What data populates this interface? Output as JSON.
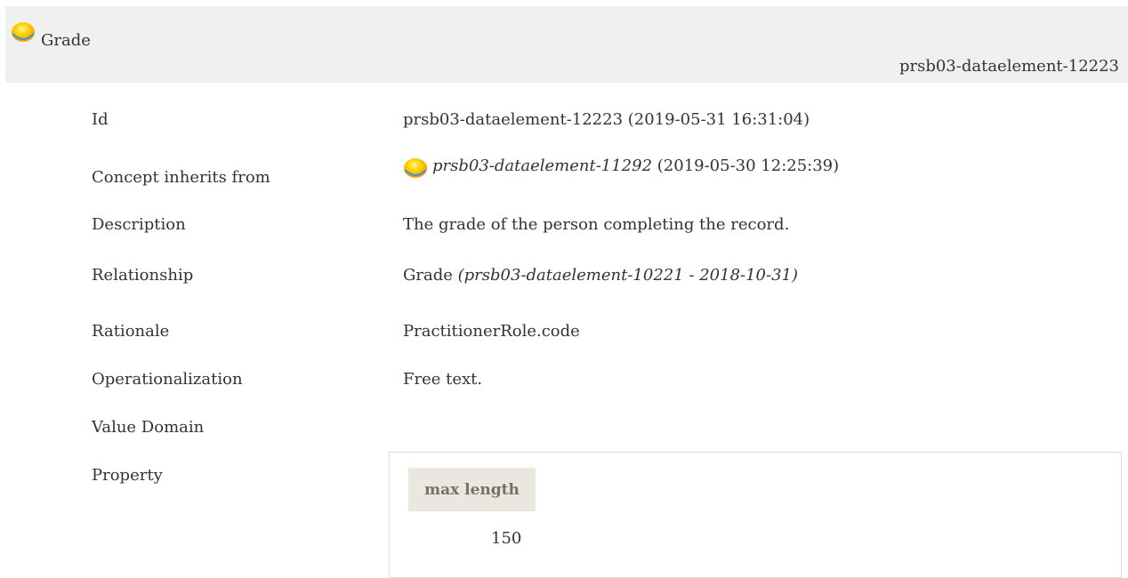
{
  "header": {
    "title": "Grade",
    "id": "prsb03-dataelement-12223",
    "orb_color": "#f5c300"
  },
  "rows": {
    "id": {
      "label": "Id",
      "value": "prsb03-dataelement-12223 (2019-05-31 16:31:04)"
    },
    "inherits": {
      "label": "Concept inherits from",
      "link": "prsb03-dataelement-11292",
      "suffix": " (2019-05-30 12:25:39)"
    },
    "description": {
      "label": "Description",
      "value": "The grade of the person completing the record."
    },
    "relationship": {
      "label": "Relationship",
      "name": "Grade ",
      "ref": "(prsb03-dataelement-10221 - 2018-10-31)"
    },
    "rationale": {
      "label": "Rationale",
      "value": "PractitionerRole.code"
    },
    "operationalization": {
      "label": "Operationalization",
      "value": "Free text."
    },
    "value_domain": {
      "label": "Value Domain",
      "value": ""
    },
    "property": {
      "label": "Property"
    }
  },
  "property_table": {
    "header": "max length",
    "value": "150"
  }
}
